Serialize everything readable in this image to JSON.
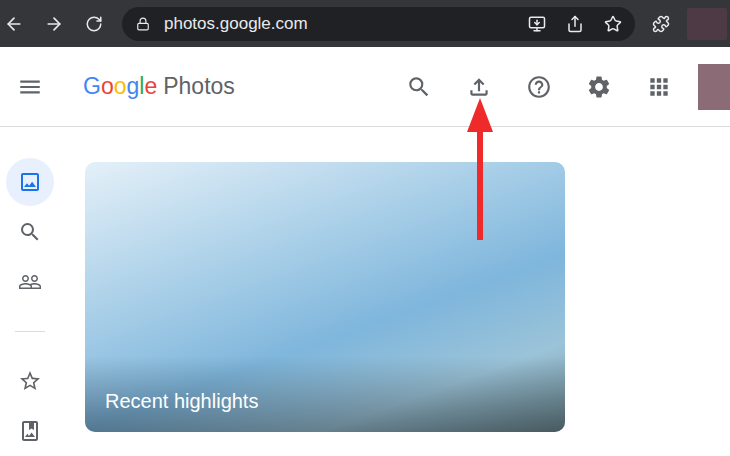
{
  "browser": {
    "url": "photos.google.com"
  },
  "header": {
    "logo": {
      "brand": "Google",
      "product": "Photos"
    }
  },
  "sidebar": {
    "items": [
      {
        "selected": true
      },
      {
        "selected": false
      },
      {
        "selected": false
      },
      {
        "selected": false
      },
      {
        "selected": false
      }
    ]
  },
  "highlights": [
    {
      "title": "Recent highlights"
    }
  ]
}
